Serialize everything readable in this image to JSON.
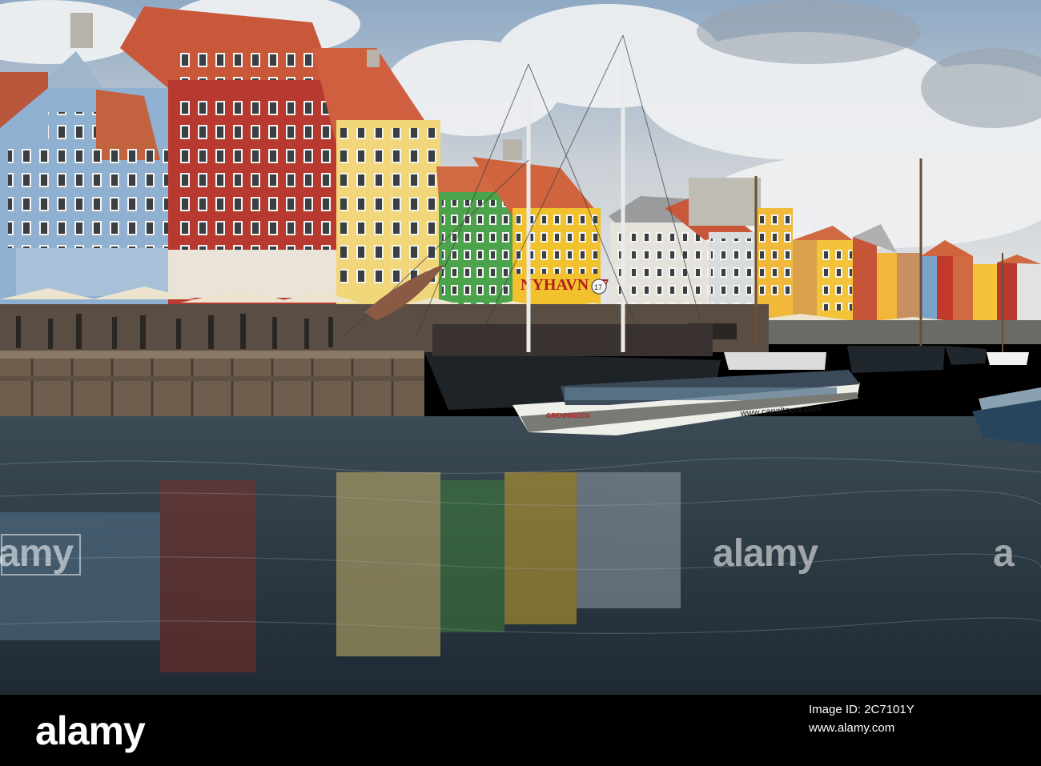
{
  "photo": {
    "boat_sign_name": "GRENNINGEN",
    "boat_sign_url": "www.canaltours.com",
    "building_sign": "NYHAVN 17",
    "building_sign_number": "17"
  },
  "watermark": {
    "left": "alamy",
    "center": "alamy",
    "right": "a"
  },
  "footer": {
    "logo": "alamy",
    "image_id": "Image ID: 2C7101Y",
    "site": "www.alamy.com"
  }
}
